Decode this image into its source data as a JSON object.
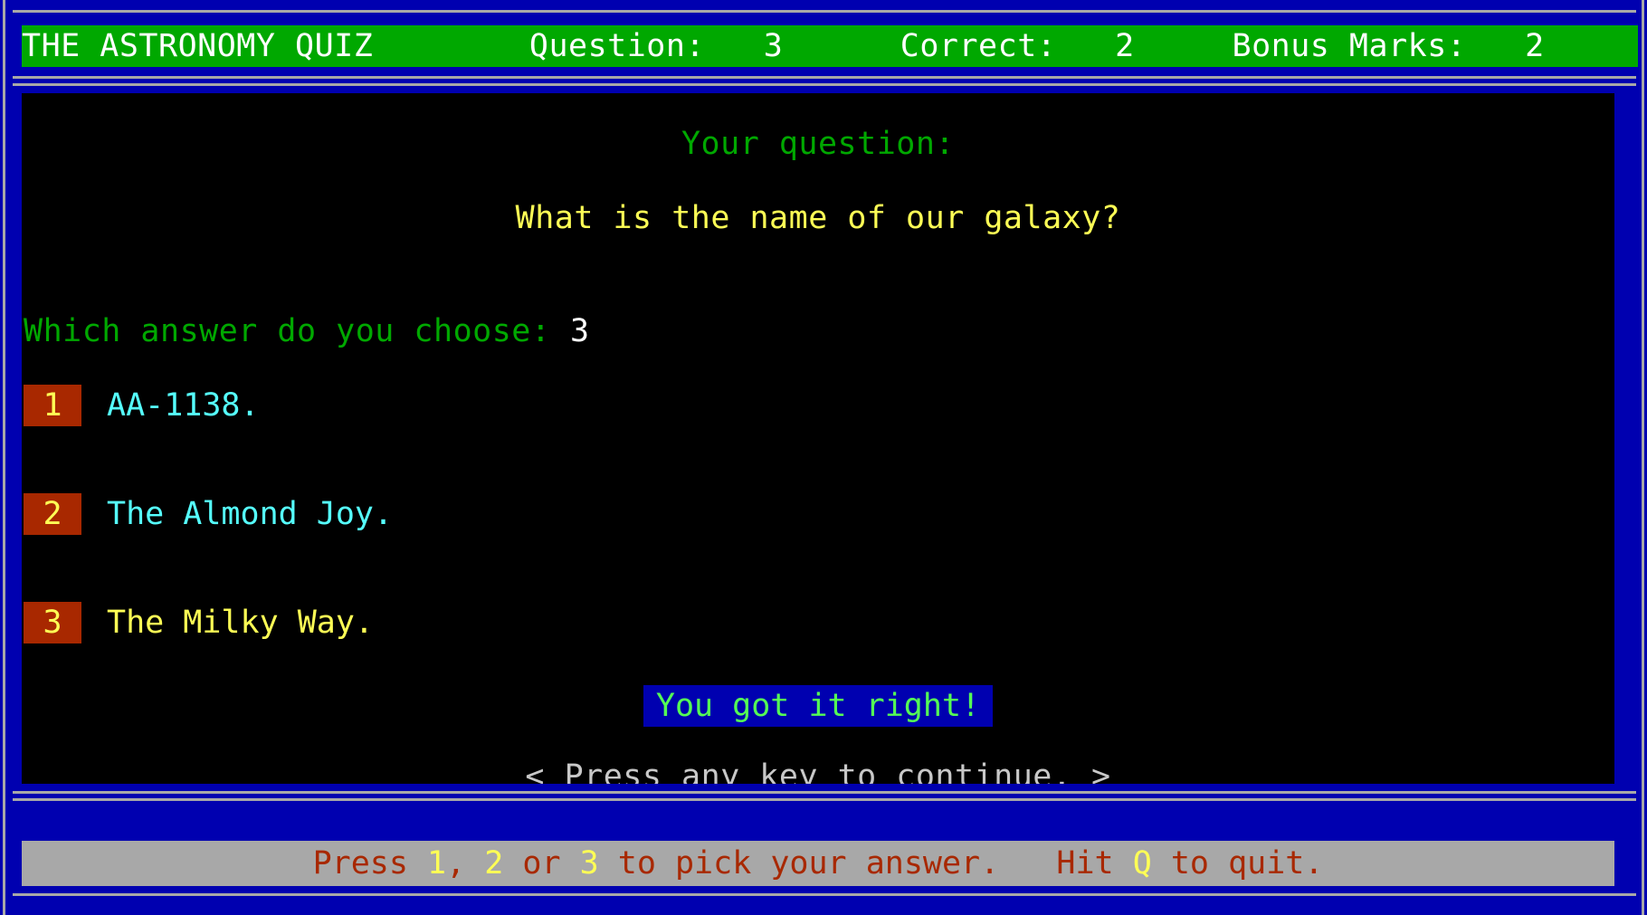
{
  "header": {
    "title": "THE ASTRONOMY QUIZ",
    "question_label": "Question:",
    "question_value": "3",
    "correct_label": "Correct:",
    "correct_value": "2",
    "bonus_label": "Bonus Marks:",
    "bonus_value": "2",
    "bg_color": "#00a800",
    "fg_color": "#ffffff"
  },
  "screen": {
    "prompt_heading": "Your question:",
    "question_text": "What is the name of our galaxy?",
    "choose_label": "Which answer do you choose:",
    "choose_value": "3",
    "answers": [
      {
        "key": "1",
        "text": "AA-1138."
      },
      {
        "key": "2",
        "text": "The Almond Joy."
      },
      {
        "key": "3",
        "text": "The Milky Way."
      }
    ],
    "result_message": "You got it right!",
    "continue_message": "< Press any key to continue. >"
  },
  "footer": {
    "press_word": "Press ",
    "key1": "1",
    "sep1": ", ",
    "key2": "2",
    "sep2": " or ",
    "key3": "3",
    "pick_text": " to pick your answer.   Hit ",
    "quit_key": "Q",
    "quit_text": " to quit."
  },
  "colors": {
    "frame_blue": "#0000b0",
    "rail_silver": "#a8a8a8",
    "screen_black": "#000000",
    "badge_red": "#a82800",
    "answer_cyan": "#55ffff",
    "answer_yellow": "#ffff55",
    "prompt_green": "#00a800",
    "result_green": "#55ff55"
  }
}
